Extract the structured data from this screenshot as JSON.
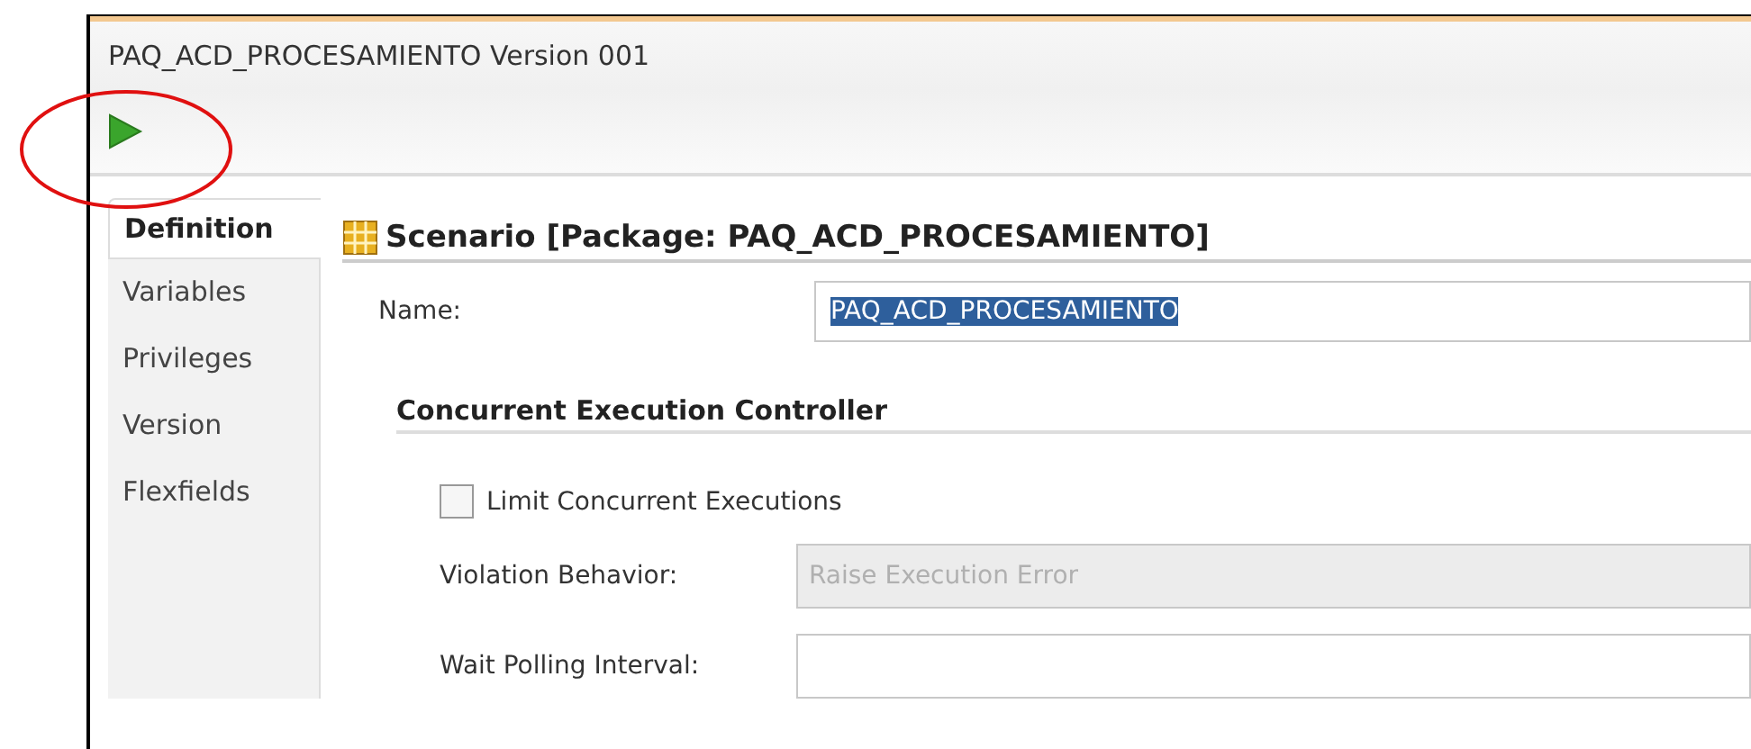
{
  "window": {
    "title": "PAQ_ACD_PROCESAMIENTO Version 001"
  },
  "toolbar": {
    "run_highlighted": true
  },
  "tabs": [
    {
      "label": "Definition",
      "selected": true
    },
    {
      "label": "Variables",
      "selected": false
    },
    {
      "label": "Privileges",
      "selected": false
    },
    {
      "label": "Version",
      "selected": false
    },
    {
      "label": "Flexfields",
      "selected": false
    }
  ],
  "header": "Scenario [Package: PAQ_ACD_PROCESAMIENTO]",
  "name_field": {
    "label": "Name:",
    "value": "PAQ_ACD_PROCESAMIENTO",
    "selected_text": true
  },
  "section": {
    "title": "Concurrent Execution Controller",
    "checkbox": {
      "label": "Limit Concurrent Executions",
      "checked": false
    },
    "fields": [
      {
        "label": "Violation Behavior:",
        "value": "Raise Execution Error",
        "disabled": true
      },
      {
        "label": "Wait Polling Interval:",
        "disabled": false
      }
    ]
  }
}
